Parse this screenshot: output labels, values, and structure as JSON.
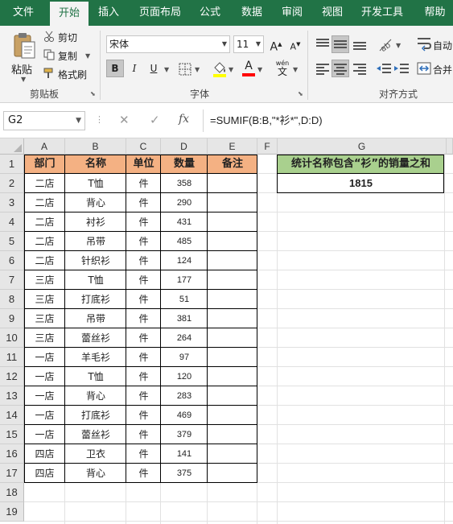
{
  "tabs": [
    "文件",
    "开始",
    "插入",
    "页面布局",
    "公式",
    "数据",
    "审阅",
    "视图",
    "开发工具",
    "帮助"
  ],
  "active_tab": "开始",
  "ribbon": {
    "clipboard": {
      "paste": "粘贴",
      "cut": "剪切",
      "copy": "复制",
      "format_painter": "格式刷",
      "group_label": "剪贴板"
    },
    "font": {
      "font_name": "宋体",
      "font_size": "11",
      "bold": "B",
      "italic": "I",
      "underline": "U",
      "increase_size": "A",
      "decrease_size": "A",
      "font_color_glyph": "A",
      "phonetic_glyph": "wén",
      "group_label": "字体"
    },
    "alignment": {
      "wrap_text": "自动",
      "merge": "合并",
      "group_label": "对齐方式"
    }
  },
  "formula_bar": {
    "name_box": "G2",
    "formula": "=SUMIF(B:B,\"*衫*\",D:D)",
    "fx": "fx"
  },
  "columns": [
    "A",
    "B",
    "C",
    "D",
    "E",
    "F",
    "G"
  ],
  "rows": [
    "1",
    "2",
    "3",
    "4",
    "5",
    "6",
    "7",
    "8",
    "9",
    "10",
    "11",
    "12",
    "13",
    "14",
    "15",
    "16",
    "17",
    "18",
    "19"
  ],
  "table": {
    "headers": [
      "部门",
      "名称",
      "单位",
      "数量",
      "备注"
    ],
    "rows": [
      [
        "二店",
        "T恤",
        "件",
        "358",
        ""
      ],
      [
        "二店",
        "背心",
        "件",
        "290",
        ""
      ],
      [
        "二店",
        "衬衫",
        "件",
        "431",
        ""
      ],
      [
        "二店",
        "吊带",
        "件",
        "485",
        ""
      ],
      [
        "二店",
        "针织衫",
        "件",
        "124",
        ""
      ],
      [
        "三店",
        "T恤",
        "件",
        "177",
        ""
      ],
      [
        "三店",
        "打底衫",
        "件",
        "51",
        ""
      ],
      [
        "三店",
        "吊带",
        "件",
        "381",
        ""
      ],
      [
        "三店",
        "蕾丝衫",
        "件",
        "264",
        ""
      ],
      [
        "一店",
        "羊毛衫",
        "件",
        "97",
        ""
      ],
      [
        "一店",
        "T恤",
        "件",
        "120",
        ""
      ],
      [
        "一店",
        "背心",
        "件",
        "283",
        ""
      ],
      [
        "一店",
        "打底衫",
        "件",
        "469",
        ""
      ],
      [
        "一店",
        "蕾丝衫",
        "件",
        "379",
        ""
      ],
      [
        "四店",
        "卫衣",
        "件",
        "141",
        ""
      ],
      [
        "四店",
        "背心",
        "件",
        "375",
        ""
      ]
    ]
  },
  "summary": {
    "label": "统计名称包含“衫”的销量之和",
    "value": "1815"
  },
  "colors": {
    "ribbon_green": "#217346",
    "header_orange": "#f4b183",
    "summary_green": "#a9d08e"
  }
}
